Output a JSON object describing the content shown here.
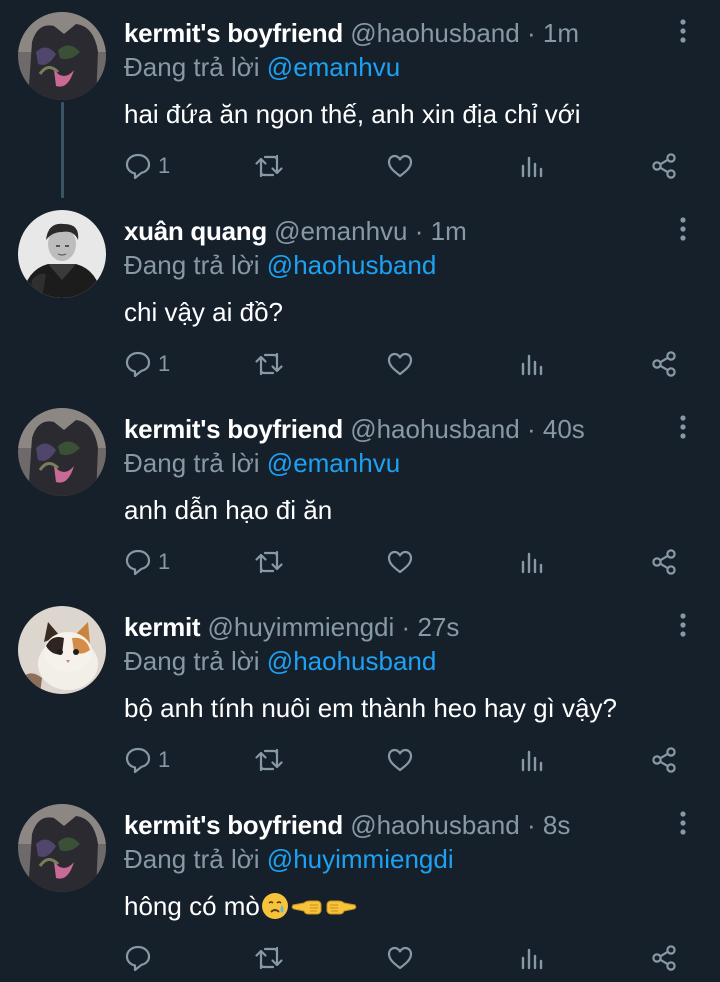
{
  "colors": {
    "background": "#15202b",
    "text_primary": "#ffffff",
    "text_secondary": "#8899a6",
    "link": "#1da1f2",
    "thread_line": "#3d5466"
  },
  "labels": {
    "replying_to": "Đang trả lời",
    "separator": "·"
  },
  "tweets": [
    {
      "display_name": "kermit's boyfriend",
      "handle": "@haohusband",
      "time": "1m",
      "reply_to": "@emanhvu",
      "text": "hai đứa ăn ngon thế, anh xin địa chỉ với",
      "reply_count": "1",
      "avatar_icon": "dark-cat-avatar"
    },
    {
      "display_name": "xuân quang",
      "handle": "@emanhvu",
      "time": "1m",
      "reply_to": "@haohusband",
      "text": "chi vậy ai đồ?",
      "reply_count": "1",
      "avatar_icon": "monochrome-person-avatar"
    },
    {
      "display_name": "kermit's boyfriend",
      "handle": "@haohusband",
      "time": "40s",
      "reply_to": "@emanhvu",
      "text": "anh dẫn hạo đi ăn",
      "reply_count": "1",
      "avatar_icon": "dark-cat-avatar"
    },
    {
      "display_name": "kermit",
      "handle": "@huyimmiengdi",
      "time": "27s",
      "reply_to": "@haohusband",
      "text": "bộ anh tính nuôi em thành heo hay gì vậy?",
      "reply_count": "1",
      "avatar_icon": "calico-cat-avatar"
    },
    {
      "display_name": "kermit's boyfriend",
      "handle": "@haohusband",
      "time": "8s",
      "reply_to": "@huyimmiengdi",
      "text": "hông có mò",
      "reply_count": "",
      "avatar_icon": "dark-cat-avatar",
      "trailing_emoji": [
        "crying-face-emoji",
        "pointing-left-hand-emoji",
        "pointing-right-hand-emoji"
      ]
    }
  ]
}
